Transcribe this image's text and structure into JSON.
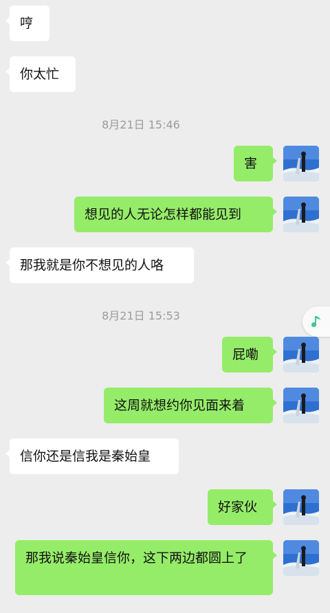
{
  "messages": [
    {
      "side": "in",
      "text": "哼"
    },
    {
      "side": "in",
      "text": "你太忙"
    },
    {
      "side": "out",
      "text": "害"
    },
    {
      "side": "out",
      "text": "想见的人无论怎样都能见到"
    },
    {
      "side": "in",
      "text": "那我就是你不想见的人咯"
    },
    {
      "side": "out",
      "text": "屁嘞"
    },
    {
      "side": "out",
      "text": "这周就想约你见面来着"
    },
    {
      "side": "in",
      "text": "信你还是信我是秦始皇"
    },
    {
      "side": "out",
      "text": "好家伙"
    },
    {
      "side": "out",
      "text": "那我说秦始皇信你，这下两边都圆上了"
    }
  ],
  "timestamps": [
    "8月21日 15:46",
    "8月21日 15:53"
  ],
  "colors": {
    "background": "#ededed",
    "incoming_bubble": "#ffffff",
    "outgoing_bubble": "#95ec69",
    "timestamp": "#9b9b9b",
    "music_note": "#3cc98a"
  },
  "icons": {
    "avatar": "avatar-photo-snowy-mountain",
    "floating": "music-note-icon"
  }
}
